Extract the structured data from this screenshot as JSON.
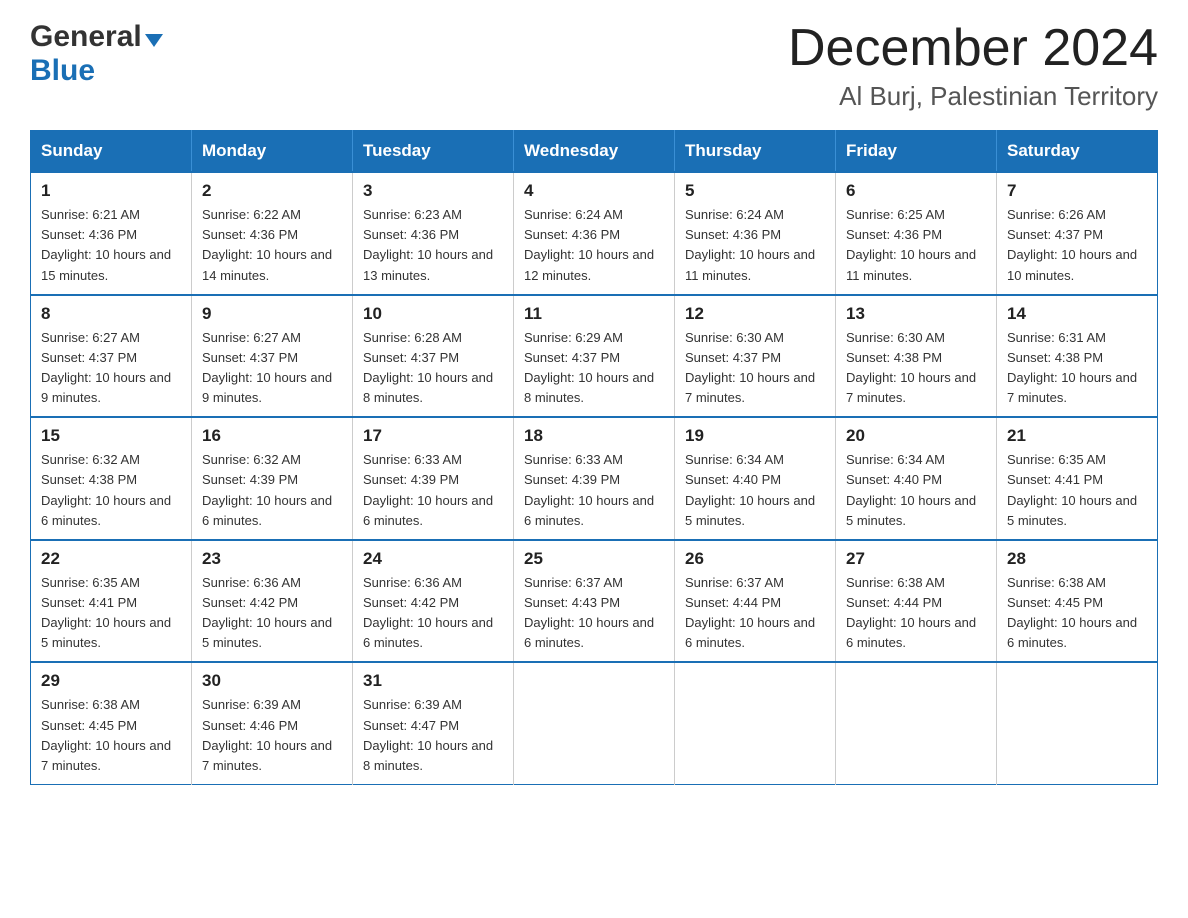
{
  "header": {
    "logo_line1": "General",
    "logo_line2": "Blue",
    "title": "December 2024",
    "subtitle": "Al Burj, Palestinian Territory"
  },
  "calendar": {
    "weekdays": [
      "Sunday",
      "Monday",
      "Tuesday",
      "Wednesday",
      "Thursday",
      "Friday",
      "Saturday"
    ],
    "weeks": [
      [
        {
          "day": "1",
          "sunrise": "6:21 AM",
          "sunset": "4:36 PM",
          "daylight": "10 hours and 15 minutes."
        },
        {
          "day": "2",
          "sunrise": "6:22 AM",
          "sunset": "4:36 PM",
          "daylight": "10 hours and 14 minutes."
        },
        {
          "day": "3",
          "sunrise": "6:23 AM",
          "sunset": "4:36 PM",
          "daylight": "10 hours and 13 minutes."
        },
        {
          "day": "4",
          "sunrise": "6:24 AM",
          "sunset": "4:36 PM",
          "daylight": "10 hours and 12 minutes."
        },
        {
          "day": "5",
          "sunrise": "6:24 AM",
          "sunset": "4:36 PM",
          "daylight": "10 hours and 11 minutes."
        },
        {
          "day": "6",
          "sunrise": "6:25 AM",
          "sunset": "4:36 PM",
          "daylight": "10 hours and 11 minutes."
        },
        {
          "day": "7",
          "sunrise": "6:26 AM",
          "sunset": "4:37 PM",
          "daylight": "10 hours and 10 minutes."
        }
      ],
      [
        {
          "day": "8",
          "sunrise": "6:27 AM",
          "sunset": "4:37 PM",
          "daylight": "10 hours and 9 minutes."
        },
        {
          "day": "9",
          "sunrise": "6:27 AM",
          "sunset": "4:37 PM",
          "daylight": "10 hours and 9 minutes."
        },
        {
          "day": "10",
          "sunrise": "6:28 AM",
          "sunset": "4:37 PM",
          "daylight": "10 hours and 8 minutes."
        },
        {
          "day": "11",
          "sunrise": "6:29 AM",
          "sunset": "4:37 PM",
          "daylight": "10 hours and 8 minutes."
        },
        {
          "day": "12",
          "sunrise": "6:30 AM",
          "sunset": "4:37 PM",
          "daylight": "10 hours and 7 minutes."
        },
        {
          "day": "13",
          "sunrise": "6:30 AM",
          "sunset": "4:38 PM",
          "daylight": "10 hours and 7 minutes."
        },
        {
          "day": "14",
          "sunrise": "6:31 AM",
          "sunset": "4:38 PM",
          "daylight": "10 hours and 7 minutes."
        }
      ],
      [
        {
          "day": "15",
          "sunrise": "6:32 AM",
          "sunset": "4:38 PM",
          "daylight": "10 hours and 6 minutes."
        },
        {
          "day": "16",
          "sunrise": "6:32 AM",
          "sunset": "4:39 PM",
          "daylight": "10 hours and 6 minutes."
        },
        {
          "day": "17",
          "sunrise": "6:33 AM",
          "sunset": "4:39 PM",
          "daylight": "10 hours and 6 minutes."
        },
        {
          "day": "18",
          "sunrise": "6:33 AM",
          "sunset": "4:39 PM",
          "daylight": "10 hours and 6 minutes."
        },
        {
          "day": "19",
          "sunrise": "6:34 AM",
          "sunset": "4:40 PM",
          "daylight": "10 hours and 5 minutes."
        },
        {
          "day": "20",
          "sunrise": "6:34 AM",
          "sunset": "4:40 PM",
          "daylight": "10 hours and 5 minutes."
        },
        {
          "day": "21",
          "sunrise": "6:35 AM",
          "sunset": "4:41 PM",
          "daylight": "10 hours and 5 minutes."
        }
      ],
      [
        {
          "day": "22",
          "sunrise": "6:35 AM",
          "sunset": "4:41 PM",
          "daylight": "10 hours and 5 minutes."
        },
        {
          "day": "23",
          "sunrise": "6:36 AM",
          "sunset": "4:42 PM",
          "daylight": "10 hours and 5 minutes."
        },
        {
          "day": "24",
          "sunrise": "6:36 AM",
          "sunset": "4:42 PM",
          "daylight": "10 hours and 6 minutes."
        },
        {
          "day": "25",
          "sunrise": "6:37 AM",
          "sunset": "4:43 PM",
          "daylight": "10 hours and 6 minutes."
        },
        {
          "day": "26",
          "sunrise": "6:37 AM",
          "sunset": "4:44 PM",
          "daylight": "10 hours and 6 minutes."
        },
        {
          "day": "27",
          "sunrise": "6:38 AM",
          "sunset": "4:44 PM",
          "daylight": "10 hours and 6 minutes."
        },
        {
          "day": "28",
          "sunrise": "6:38 AM",
          "sunset": "4:45 PM",
          "daylight": "10 hours and 6 minutes."
        }
      ],
      [
        {
          "day": "29",
          "sunrise": "6:38 AM",
          "sunset": "4:45 PM",
          "daylight": "10 hours and 7 minutes."
        },
        {
          "day": "30",
          "sunrise": "6:39 AM",
          "sunset": "4:46 PM",
          "daylight": "10 hours and 7 minutes."
        },
        {
          "day": "31",
          "sunrise": "6:39 AM",
          "sunset": "4:47 PM",
          "daylight": "10 hours and 8 minutes."
        },
        null,
        null,
        null,
        null
      ]
    ]
  }
}
